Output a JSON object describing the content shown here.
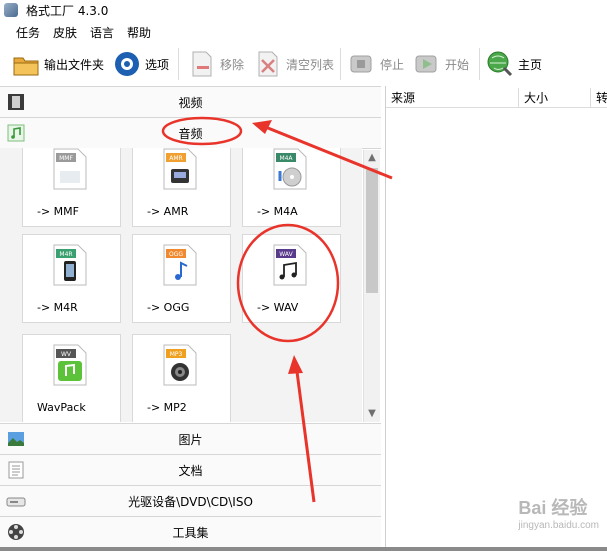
{
  "window": {
    "title": "格式工厂 4.3.0"
  },
  "menu": [
    "任务",
    "皮肤",
    "语言",
    "帮助"
  ],
  "toolbar": {
    "output_folder": "输出文件夹",
    "options": "选项",
    "remove": "移除",
    "clear_list": "清空列表",
    "stop": "停止",
    "start": "开始",
    "home": "主页"
  },
  "categories": {
    "video": "视频",
    "audio": "音频",
    "image": "图片",
    "document": "文档",
    "disc": "光驱设备\\DVD\\CD\\ISO",
    "tools": "工具集"
  },
  "audio_tiles": [
    {
      "badge": "MMF",
      "label": "-> MMF",
      "color": "#9a9a9a"
    },
    {
      "badge": "AMR",
      "label": "-> AMR",
      "color": "#f0a030"
    },
    {
      "badge": "M4A",
      "label": "-> M4A",
      "color": "#3a8a6a"
    },
    {
      "badge": "M4R",
      "label": "-> M4R",
      "color": "#3aa070"
    },
    {
      "badge": "OGG",
      "label": "-> OGG",
      "color": "#f08a30"
    },
    {
      "badge": "WAV",
      "label": "-> WAV",
      "color": "#5a3a8a"
    },
    {
      "badge": "WV",
      "label": "WavPack",
      "color": "#555555"
    },
    {
      "badge": "MP3",
      "label": "-> MP2",
      "color": "#f0a020"
    }
  ],
  "file_list": {
    "columns": [
      "来源",
      "大小",
      "转"
    ]
  },
  "watermark": {
    "main": "Bai 经验",
    "sub": "jingyan.baidu.com"
  },
  "colors": {
    "annotation": "#e8342a"
  }
}
